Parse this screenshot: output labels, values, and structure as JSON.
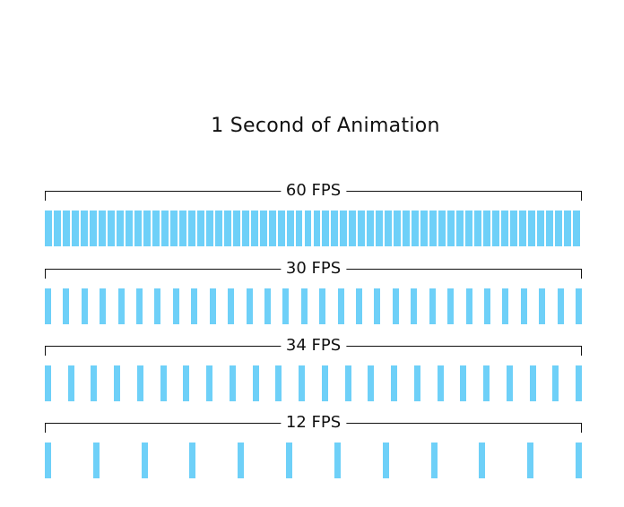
{
  "title": "1 Second of Animation",
  "frame_color": "#6ed0f8",
  "rows": [
    {
      "label": "60 FPS",
      "frames": 60
    },
    {
      "label": "30 FPS",
      "frames": 30
    },
    {
      "label": "34 FPS",
      "frames": 24
    },
    {
      "label": "12 FPS",
      "frames": 12
    }
  ]
}
